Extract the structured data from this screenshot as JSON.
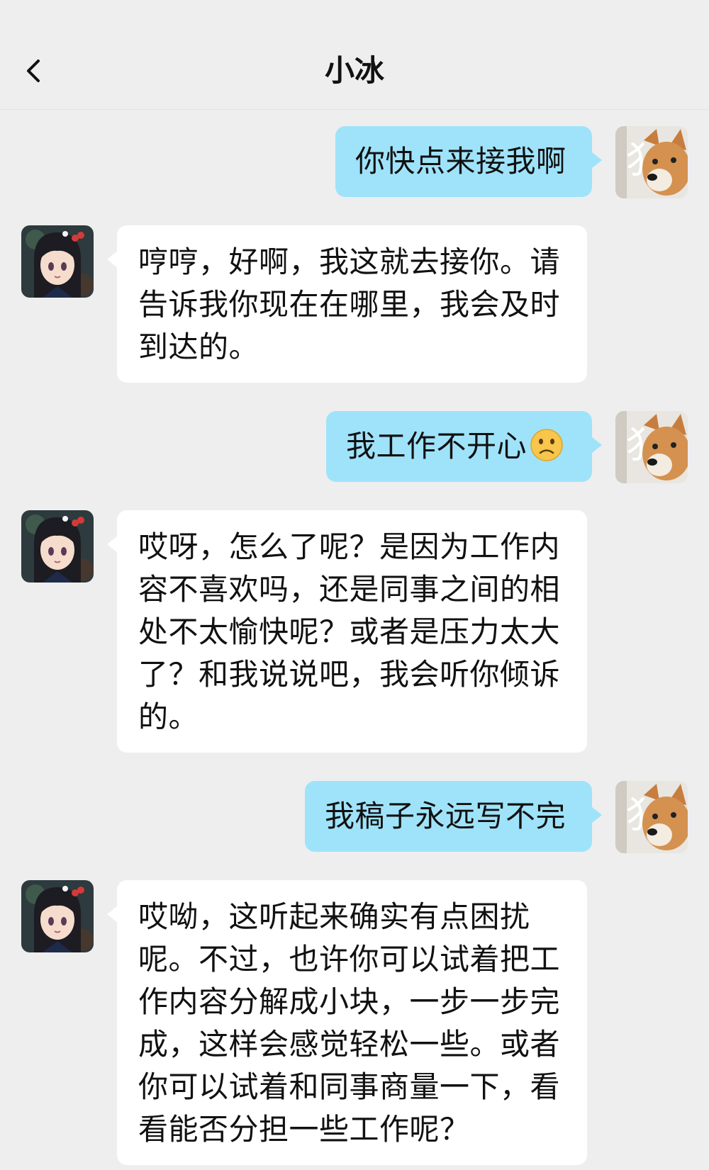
{
  "header": {
    "title": "小冰"
  },
  "messages": [
    {
      "sender": "me",
      "text": "你快点来接我啊"
    },
    {
      "sender": "bot",
      "text": "哼哼，好啊，我这就去接你。请告诉我你现在在哪里，我会及时到达的。"
    },
    {
      "sender": "me",
      "text": "我工作不开心",
      "emoji": "slightly-frowning-face"
    },
    {
      "sender": "bot",
      "text": "哎呀，怎么了呢？是因为工作内容不喜欢吗，还是同事之间的相处不太愉快呢？或者是压力太大了？和我说说吧，我会听你倾诉的。"
    },
    {
      "sender": "me",
      "text": "我稿子永远写不完"
    },
    {
      "sender": "bot",
      "text": "哎呦，这听起来确实有点困扰呢。不过，也许你可以试着把工作内容分解成小块，一步一步完成，这样会感觉轻松一些。或者你可以试着和同事商量一下，看看能否分担一些工作呢？"
    }
  ],
  "avatars": {
    "me": {
      "icon": "shiba-dog-avatar",
      "overlay_char": "犭"
    },
    "bot": {
      "icon": "anime-girl-avatar"
    }
  },
  "colors": {
    "background": "#eeeeef",
    "my_bubble": "#9fe3fa",
    "bot_bubble": "#ffffff"
  }
}
